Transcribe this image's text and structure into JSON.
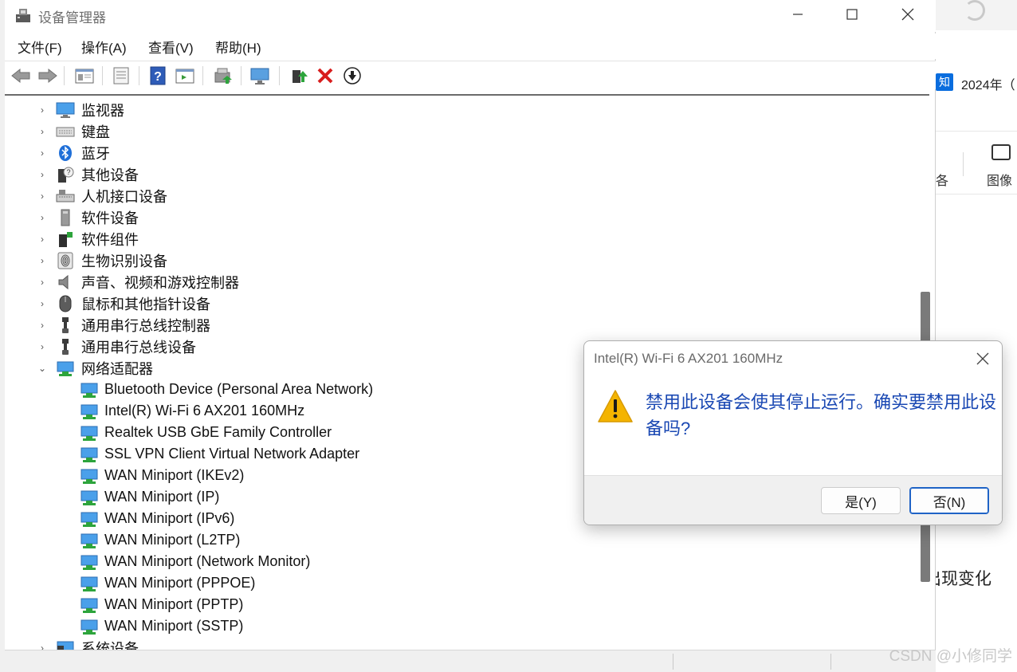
{
  "window": {
    "title": "设备管理器"
  },
  "menu": {
    "file": "文件(F)",
    "action": "操作(A)",
    "view": "查看(V)",
    "help": "帮助(H)"
  },
  "tree": {
    "categories": [
      {
        "label": "监视器",
        "icon": "monitor-icon"
      },
      {
        "label": "键盘",
        "icon": "keyboard-icon"
      },
      {
        "label": "蓝牙",
        "icon": "bluetooth-icon"
      },
      {
        "label": "其他设备",
        "icon": "other-device-icon"
      },
      {
        "label": "人机接口设备",
        "icon": "hid-icon"
      },
      {
        "label": "软件设备",
        "icon": "software-device-icon"
      },
      {
        "label": "软件组件",
        "icon": "software-component-icon"
      },
      {
        "label": "生物识别设备",
        "icon": "fingerprint-icon"
      },
      {
        "label": "声音、视频和游戏控制器",
        "icon": "speaker-icon"
      },
      {
        "label": "鼠标和其他指针设备",
        "icon": "mouse-icon"
      },
      {
        "label": "通用串行总线控制器",
        "icon": "usb-icon"
      },
      {
        "label": "通用串行总线设备",
        "icon": "usb-icon"
      }
    ],
    "network_adapters": {
      "label": "网络适配器",
      "icon": "network-adapter-icon",
      "children": [
        "Bluetooth Device (Personal Area Network)",
        "Intel(R) Wi-Fi 6 AX201 160MHz",
        "Realtek USB GbE Family Controller",
        "SSL VPN Client Virtual Network Adapter",
        "WAN Miniport (IKEv2)",
        "WAN Miniport (IP)",
        "WAN Miniport (IPv6)",
        "WAN Miniport (L2TP)",
        "WAN Miniport (Network Monitor)",
        "WAN Miniport (PPPOE)",
        "WAN Miniport (PPTP)",
        "WAN Miniport (SSTP)"
      ]
    },
    "last_partial": "系统设备"
  },
  "dialog": {
    "title": "Intel(R) Wi-Fi 6 AX201 160MHz",
    "message": "禁用此设备会使其停止运行。确实要禁用此设备吗?",
    "yes_label": "是(Y)",
    "no_label": "否(N)"
  },
  "background": {
    "zhi": "知",
    "year_text": "2024年（",
    "partial_ge": "各",
    "image_label": "图像",
    "change_text": "出现变化",
    "watermark": "CSDN @小修同学"
  },
  "colors": {
    "dialog_message": "#1a48b3",
    "focus_button_border": "#1f63c6",
    "warning": "#f4b400"
  }
}
